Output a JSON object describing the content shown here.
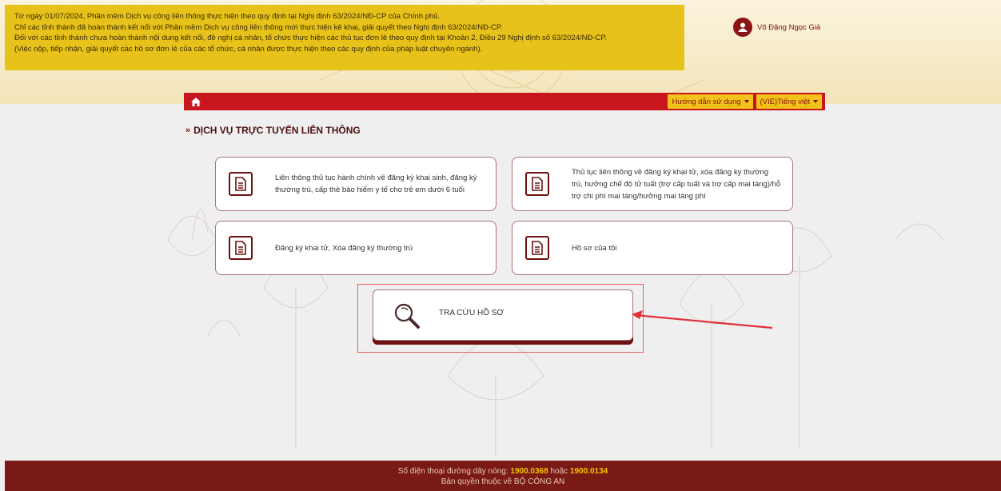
{
  "notice": {
    "lines": [
      "Từ ngày 01/07/2024, Phần mềm Dịch vụ công liên thông thực hiện theo quy định tại Nghị định 63/2024/NĐ-CP của Chính phủ.",
      "Chỉ các tỉnh thành đã hoàn thành kết nối với Phần mềm Dịch vụ công liên thông mới thực hiện kê khai, giải quyết theo Nghị định 63/2024/NĐ-CP.",
      "Đối với các tỉnh thành chưa hoàn thành nội dung kết nối, đề nghị cá nhân, tổ chức thực hiện các thủ tục đơn lẻ theo quy định tại Khoản 2, Điều 29 Nghị định số 63/2024/NĐ-CP.",
      "(Việc nộp, tiếp nhận, giải quyết các hồ sơ đơn lẻ của các tổ chức, cá nhân được thực hiện theo các quy định của pháp luật chuyên ngành)."
    ]
  },
  "user": {
    "name": "Võ Đặng Ngọc Giả"
  },
  "nav": {
    "home_icon": "home-icon",
    "guide_label": "Hướng dẫn sử dụng",
    "language_label": "(VIE)Tiếng việt"
  },
  "section": {
    "chevrons": "»",
    "title": "DỊCH VỤ TRỰC TUYẾN LIÊN THÔNG"
  },
  "services": [
    {
      "label": "Liên thông thủ tục hành chính về đăng ký khai sinh, đăng ký thường trú, cấp thẻ bảo hiểm y tế cho trẻ em dưới 6 tuổi",
      "icon": "document-icon"
    },
    {
      "label": "Thủ tục liên thông về đăng ký khai tử, xóa đăng ký thường trú, hưởng chế độ tử tuất (trợ cấp tuất và trợ cấp mai táng)/hỗ trợ chi phí mai táng/hưởng mai táng phí",
      "icon": "document-icon"
    },
    {
      "label": "Đăng ký khai tử, Xóa đăng ký thường trú",
      "icon": "document-icon"
    },
    {
      "label": "Hồ sơ của tôi",
      "icon": "document-icon"
    }
  ],
  "lookup": {
    "label": "TRA CỨU HỒ SƠ",
    "icon": "search-icon"
  },
  "footer": {
    "hotline_prefix": "Số điện thoại đường dây nóng:",
    "hotline_1": "1900.0368",
    "hotline_sep": "hoặc",
    "hotline_2": "1900.0134",
    "copyright": "Bản quyền thuộc về BỘ CÔNG AN"
  },
  "colors": {
    "primary_red": "#c8161e",
    "dark_red": "#6d1111",
    "notice_yellow": "#e7c21b",
    "footer_bg": "#7a1a14"
  }
}
